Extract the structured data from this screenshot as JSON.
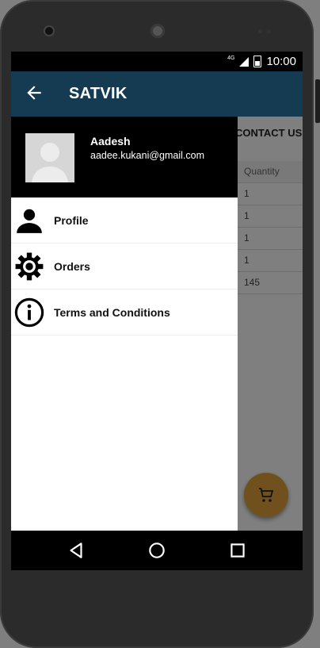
{
  "status_bar": {
    "network": "4G",
    "time": "10:00"
  },
  "toolbar": {
    "title": "SATVIK",
    "back_icon": "arrow-back-icon"
  },
  "drawer": {
    "user": {
      "name": "Aadesh",
      "email": "aadee.kukani@gmail.com"
    },
    "items": [
      {
        "label": "Profile",
        "icon": "person-icon"
      },
      {
        "label": "Orders",
        "icon": "gear-icon"
      },
      {
        "label": "Terms and Conditions",
        "icon": "info-icon"
      }
    ]
  },
  "background": {
    "tab_label": "CONTACT US",
    "table": {
      "header": "Quantity",
      "values": [
        "1",
        "1",
        "1",
        "1",
        "145"
      ]
    },
    "fab_icon": "cart-icon"
  },
  "nav_bar": {
    "buttons": [
      "back-nav-icon",
      "home-nav-icon",
      "recents-nav-icon"
    ]
  },
  "colors": {
    "toolbar": "#153b52",
    "fab": "#e1a33a"
  }
}
